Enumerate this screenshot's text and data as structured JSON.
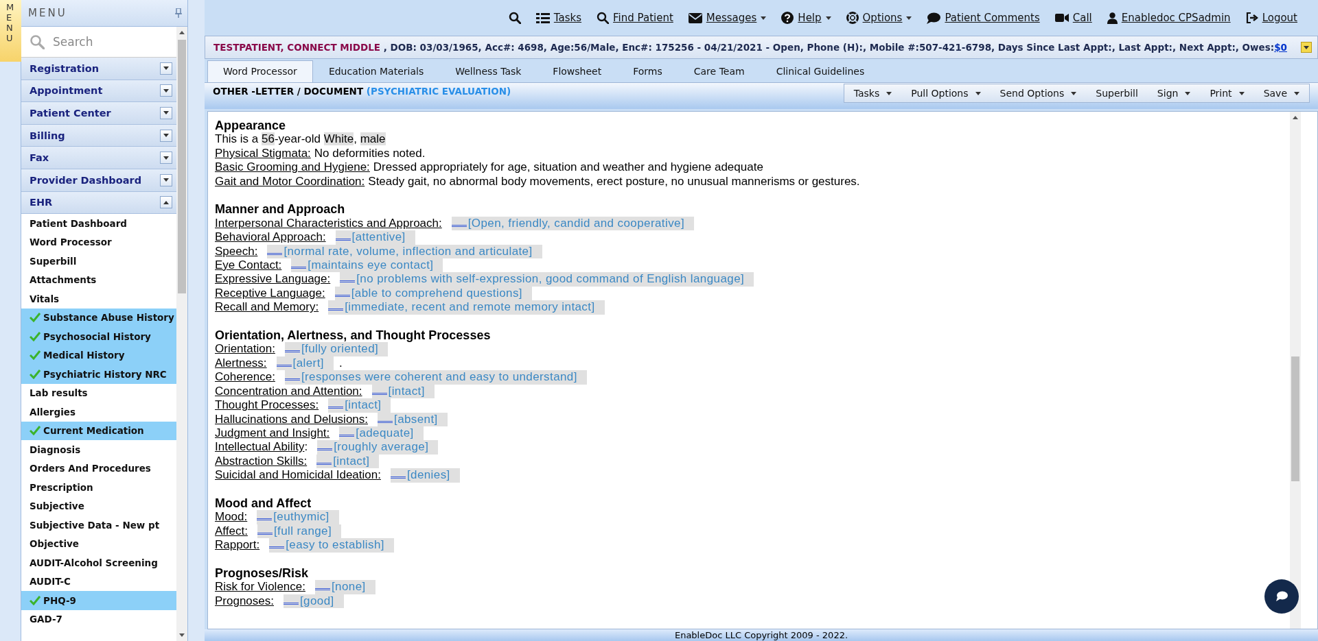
{
  "sidebar": {
    "tab_label": "MENU",
    "title": "MENU",
    "search": {
      "placeholder": "Search"
    },
    "sections": [
      {
        "label": "Registration",
        "expanded": false
      },
      {
        "label": "Appointment",
        "expanded": false
      },
      {
        "label": "Patient Center",
        "expanded": false
      },
      {
        "label": "Billing",
        "expanded": false
      },
      {
        "label": "Fax",
        "expanded": false
      },
      {
        "label": "Provider Dashboard",
        "expanded": false
      },
      {
        "label": "EHR",
        "expanded": true,
        "items": [
          {
            "label": "Patient Dashboard",
            "done": false
          },
          {
            "label": "Word Processor",
            "done": false
          },
          {
            "label": "Superbill",
            "done": false
          },
          {
            "label": "Attachments",
            "done": false
          },
          {
            "label": "Vitals",
            "done": false
          },
          {
            "label": "Substance Abuse History",
            "done": true
          },
          {
            "label": "Psychosocial History",
            "done": true
          },
          {
            "label": "Medical History",
            "done": true
          },
          {
            "label": "Psychiatric History NRC",
            "done": true
          },
          {
            "label": "Lab results",
            "done": false
          },
          {
            "label": "Allergies",
            "done": false
          },
          {
            "label": "Current Medication",
            "done": true
          },
          {
            "label": "Diagnosis",
            "done": false
          },
          {
            "label": "Orders And Procedures",
            "done": false
          },
          {
            "label": "Prescription",
            "done": false
          },
          {
            "label": "Subjective",
            "done": false
          },
          {
            "label": "Subjective Data - New pt",
            "done": false
          },
          {
            "label": "Objective",
            "done": false
          },
          {
            "label": "AUDIT-Alcohol Screening",
            "done": false
          },
          {
            "label": "AUDIT-C",
            "done": false
          },
          {
            "label": "PHQ-9",
            "done": true
          },
          {
            "label": "GAD-7",
            "done": false
          }
        ]
      }
    ]
  },
  "toolbar": [
    {
      "kind": "search"
    },
    {
      "kind": "tasks",
      "label": "Tasks",
      "dropdown": false
    },
    {
      "kind": "find",
      "label": "Find Patient",
      "dropdown": false
    },
    {
      "kind": "messages",
      "label": "Messages",
      "dropdown": true
    },
    {
      "kind": "help",
      "label": "Help",
      "dropdown": true
    },
    {
      "kind": "options",
      "label": "Options",
      "dropdown": true
    },
    {
      "kind": "comments",
      "label": "Patient Comments",
      "dropdown": false
    },
    {
      "kind": "call",
      "label": "Call",
      "dropdown": false
    },
    {
      "kind": "user",
      "label": "Enabledoc CPSadmin",
      "dropdown": false
    },
    {
      "kind": "logout",
      "label": "Logout",
      "dropdown": false
    }
  ],
  "patient_bar": {
    "name": "TESTPATIENT, CONNECT MIDDLE",
    "details": " , DOB: 03/03/1965, Acc#: 4698, Age:56/Male, Enc#: 175256 - 04/21/2021 - Open, Phone (H):, Mobile #:507-421-6798, Days Since Last Appt:, Last Appt:, Next Appt:, Owes:",
    "owes_link": "$0"
  },
  "tabs": [
    {
      "label": "Word Processor",
      "selected": true
    },
    {
      "label": "Education Materials",
      "selected": false
    },
    {
      "label": "Wellness Task",
      "selected": false
    },
    {
      "label": "Flowsheet",
      "selected": false
    },
    {
      "label": "Forms",
      "selected": false
    },
    {
      "label": "Care Team",
      "selected": false
    },
    {
      "label": "Clinical Guidelines",
      "selected": false
    }
  ],
  "document_header": {
    "title": "OTHER -LETTER / DOCUMENT",
    "subtitle": "(PSYCHIATRIC EVALUATION)"
  },
  "actions": [
    {
      "label": "Tasks",
      "dropdown": true
    },
    {
      "label": "Pull Options",
      "dropdown": true
    },
    {
      "label": "Send Options",
      "dropdown": true
    },
    {
      "label": "Superbill",
      "dropdown": false
    },
    {
      "label": "Sign",
      "dropdown": true
    },
    {
      "label": "Print",
      "dropdown": true
    },
    {
      "label": "Save",
      "dropdown": true
    }
  ],
  "document": [
    {
      "heading": "Appearance",
      "lines": [
        {
          "kind": "sentence",
          "parts": [
            {
              "text": "This is a ",
              "field": false
            },
            {
              "text": "56",
              "field": true
            },
            {
              "text": "-year-old ",
              "field": false
            },
            {
              "text": "White",
              "field": true
            },
            {
              "text": ", ",
              "field": false
            },
            {
              "text": "male",
              "field": true
            }
          ]
        },
        {
          "kind": "plain",
          "label": "Physical Stigmata:",
          "value": "No deformities noted."
        },
        {
          "kind": "plain",
          "label": "Basic Grooming and Hygiene:",
          "value": "Dressed appropriately for age, situation and weather and hygiene adequate"
        },
        {
          "kind": "plain",
          "label": "Gait and Motor Coordination:",
          "value": "Steady gait, no abnormal body movements, erect posture, no unusual mannerisms or gestures."
        }
      ]
    },
    {
      "heading": "Manner and Approach",
      "lines": [
        {
          "kind": "field",
          "label": "Interpersonal Characteristics and Approach:",
          "value": "[Open, friendly, candid and cooperative]"
        },
        {
          "kind": "field",
          "label": "Behavioral Approach:",
          "value": "[attentive]"
        },
        {
          "kind": "field",
          "label": "Speech:",
          "value": "[normal rate, volume, inflection and articulate]"
        },
        {
          "kind": "field",
          "label": "Eye Contact:",
          "value": "[maintains eye contact]"
        },
        {
          "kind": "field",
          "label": "Expressive Language:",
          "value": "[no problems with self-expression, good command of English language]"
        },
        {
          "kind": "field",
          "label": "Receptive Language:",
          "value": "[able to comprehend questions]"
        },
        {
          "kind": "field",
          "label": "Recall and Memory:",
          "value": "[immediate, recent and remote memory intact]"
        }
      ]
    },
    {
      "heading": "Orientation, Alertness, and Thought Processes",
      "lines": [
        {
          "kind": "field",
          "label": "Orientation:",
          "value": "[fully oriented]"
        },
        {
          "kind": "field",
          "label": "Alertness:",
          "value": "[alert]",
          "suffix": "."
        },
        {
          "kind": "field",
          "label": "Coherence:",
          "value": "[responses were coherent and easy to understand]"
        },
        {
          "kind": "field",
          "label": "Concentration and Attention:",
          "value": "[intact]"
        },
        {
          "kind": "field",
          "label": "Thought Processes:",
          "value": "[intact]"
        },
        {
          "kind": "field",
          "label": "Hallucinations and Delusions:",
          "value": "[absent]"
        },
        {
          "kind": "field",
          "label": "Judgment and Insight:",
          "value": "[adequate]"
        },
        {
          "kind": "field",
          "label": "Intellectual Ability",
          "value": "[roughly average]",
          "suffix_before": ":"
        },
        {
          "kind": "field",
          "label": "Abstraction Skills:",
          "value": "[intact]"
        },
        {
          "kind": "field",
          "label": "Suicidal and Homicidal Ideation:",
          "value": "[denies]"
        }
      ]
    },
    {
      "heading": "Mood and Affect",
      "lines": [
        {
          "kind": "field",
          "label": "Mood:",
          "value": "[euthymic]"
        },
        {
          "kind": "field",
          "label": "Affect:",
          "value": "[full range]"
        },
        {
          "kind": "field",
          "label": "Rapport:",
          "value": "[easy to establish]"
        }
      ]
    },
    {
      "heading": "Prognoses/Risk",
      "lines": [
        {
          "kind": "field",
          "label": "Risk for Violence:",
          "value": "[none]"
        },
        {
          "kind": "field",
          "label": "Prognoses:",
          "value": "[good]"
        }
      ]
    }
  ],
  "footer": "EnableDoc LLC Copyright 2009 - 2022."
}
